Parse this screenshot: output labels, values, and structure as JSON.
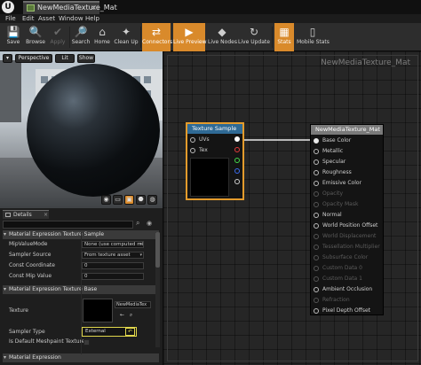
{
  "titlebar": {
    "logo": "U",
    "tab_label": "NewMediaTexture_Mat",
    "tab_close": "×"
  },
  "menu": [
    "File",
    "Edit",
    "Asset",
    "Window",
    "Help"
  ],
  "toolbar": [
    {
      "label": "Save",
      "icon": "💾",
      "state": "normal"
    },
    {
      "label": "Browse",
      "icon": "🔍",
      "state": "normal"
    },
    {
      "label": "Apply",
      "icon": "✔",
      "state": "disabled"
    },
    {
      "label": "Search",
      "icon": "🔎",
      "state": "normal"
    },
    {
      "label": "Home",
      "icon": "⌂",
      "state": "normal"
    },
    {
      "label": "Clean Up",
      "icon": "✦",
      "state": "normal"
    },
    {
      "label": "Connectors",
      "icon": "⇄",
      "state": "active"
    },
    {
      "label": "Live Preview",
      "icon": "▶",
      "state": "active"
    },
    {
      "label": "Live Nodes",
      "icon": "◆",
      "state": "normal"
    },
    {
      "label": "Live Update",
      "icon": "↻",
      "state": "normal"
    },
    {
      "label": "Stats",
      "icon": "▦",
      "state": "active"
    },
    {
      "label": "Mobile Stats",
      "icon": "▯",
      "state": "normal"
    }
  ],
  "viewport": {
    "menu_icon": "▾",
    "perspective": "Perspective",
    "lit": "Lit",
    "show": "Show",
    "shape_icons": [
      "◉",
      "▭",
      "▣",
      "⬣",
      "◍"
    ]
  },
  "details": {
    "tab": "Details",
    "tab_close": "×",
    "search_icon": "⌕",
    "eye_icon": "◉",
    "section1": "Material Expression Texture Sample",
    "props1": [
      {
        "label": "MipValueMode",
        "value": "None (use computed mip"
      },
      {
        "label": "Sampler Source",
        "value": "From texture asset"
      },
      {
        "label": "Const Coordinate",
        "value": "0"
      },
      {
        "label": "Const Mip Value",
        "value": "0"
      }
    ],
    "section2": "Material Expression Texture Base",
    "texture_label": "Texture",
    "texture_name": "NewMediaTex",
    "texture_btn1": "←",
    "texture_btn2": "⌕",
    "sampler_type_label": "Sampler Type",
    "sampler_type_value": "External",
    "reset_icon": "↶",
    "default_mesh_label": "Is Default Meshpaint Texture",
    "section3": "Material Expression"
  },
  "graph": {
    "watermark": "NewMediaTexture_Mat",
    "texture_sample": {
      "title": "Texture Sample",
      "inputs": [
        "UVs",
        "Tex"
      ],
      "outputs": [
        {
          "color": "#ffffff"
        },
        {
          "color": "#e63a3a"
        },
        {
          "color": "#44d94a"
        },
        {
          "color": "#3b6df0"
        },
        {
          "color": "#cfcfcf"
        }
      ]
    },
    "material": {
      "title": "NewMediaTexture_Mat",
      "pins": [
        {
          "label": "Base Color",
          "enabled": true,
          "connected": true
        },
        {
          "label": "Metallic",
          "enabled": true,
          "connected": false
        },
        {
          "label": "Specular",
          "enabled": true,
          "connected": false
        },
        {
          "label": "Roughness",
          "enabled": true,
          "connected": false
        },
        {
          "label": "Emissive Color",
          "enabled": true,
          "connected": false
        },
        {
          "label": "Opacity",
          "enabled": false,
          "connected": false
        },
        {
          "label": "Opacity Mask",
          "enabled": false,
          "connected": false
        },
        {
          "label": "Normal",
          "enabled": true,
          "connected": false
        },
        {
          "label": "World Position Offset",
          "enabled": true,
          "connected": false
        },
        {
          "label": "World Displacement",
          "enabled": false,
          "connected": false
        },
        {
          "label": "Tessellation Multiplier",
          "enabled": false,
          "connected": false
        },
        {
          "label": "Subsurface Color",
          "enabled": false,
          "connected": false
        },
        {
          "label": "Custom Data 0",
          "enabled": false,
          "connected": false
        },
        {
          "label": "Custom Data 1",
          "enabled": false,
          "connected": false
        },
        {
          "label": "Ambient Occlusion",
          "enabled": true,
          "connected": false
        },
        {
          "label": "Refraction",
          "enabled": false,
          "connected": false
        },
        {
          "label": "Pixel Depth Offset",
          "enabled": true,
          "connected": false
        }
      ]
    }
  },
  "colors": {
    "accent": "#d98a2b",
    "node_title_texture": "#2f6a95",
    "node_title_material": "#7a7a7a",
    "highlight": "#e0d64c"
  }
}
